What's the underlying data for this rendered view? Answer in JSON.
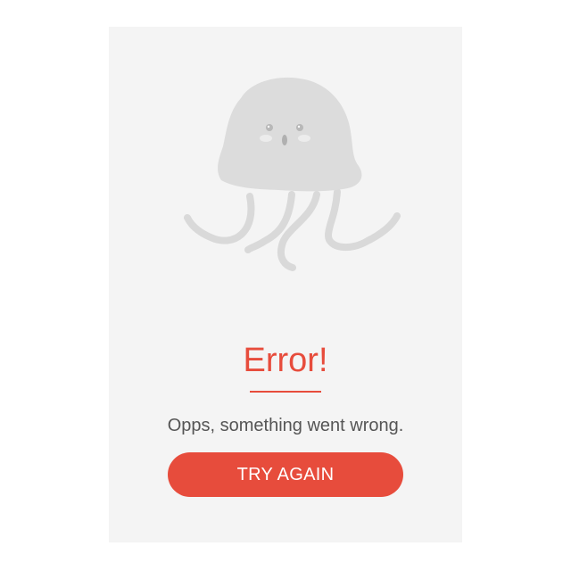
{
  "error": {
    "title": "Error!",
    "message": "Opps, something went wrong.",
    "button_label": "TRY AGAIN"
  },
  "illustration": {
    "name": "jellyfish-icon"
  },
  "colors": {
    "accent": "#e74c3c",
    "card_background": "#f4f4f4",
    "illustration": "#dedede",
    "text": "#555555"
  }
}
